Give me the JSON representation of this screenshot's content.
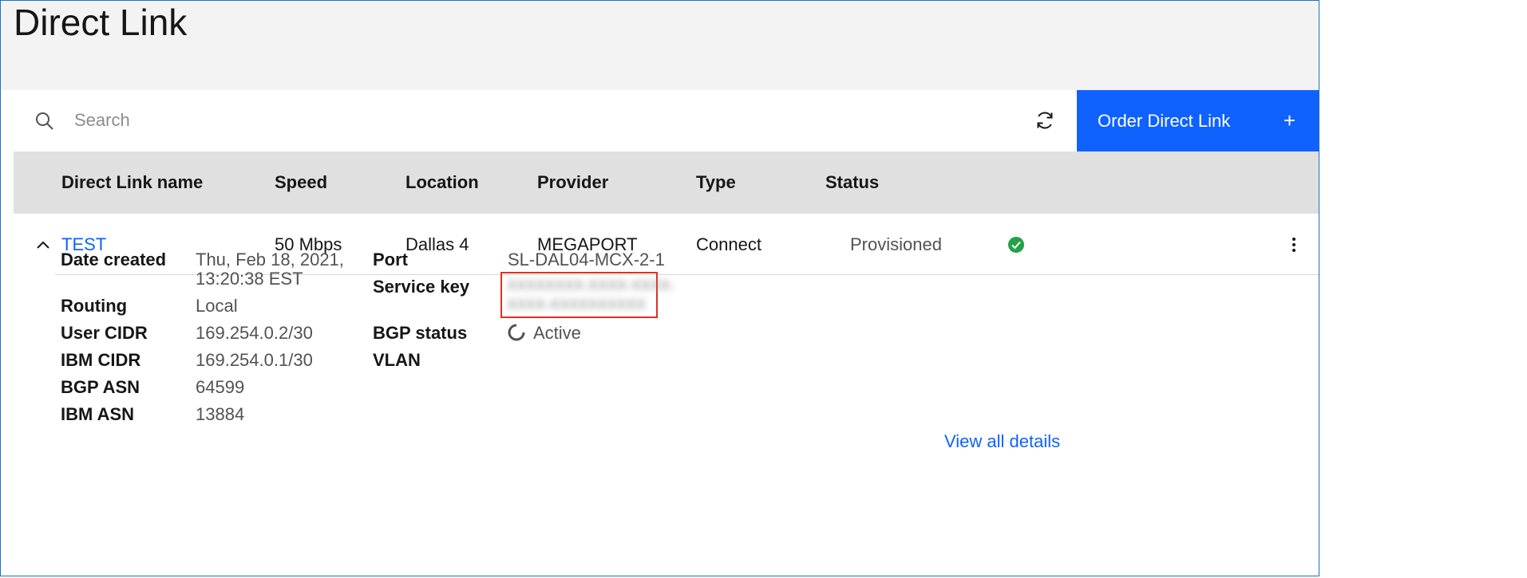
{
  "page": {
    "title": "Direct Link"
  },
  "toolbar": {
    "search_placeholder": "Search",
    "order_label": "Order Direct Link",
    "order_plus": "+"
  },
  "table": {
    "headers": [
      "Direct Link name",
      "Speed",
      "Location",
      "Provider",
      "Type",
      "Status"
    ],
    "rows": [
      {
        "name": "TEST",
        "speed": "50 Mbps",
        "location": "Dallas 4",
        "provider": "MEGAPORT",
        "type": "Connect",
        "status": "Provisioned"
      }
    ]
  },
  "details": {
    "date_created_label": "Date created",
    "date_created_line1": "Thu, Feb 18, 2021,",
    "date_created_line2": "13:20:38 EST",
    "routing_label": "Routing",
    "routing_value": "Local",
    "user_cidr_label": "User CIDR",
    "user_cidr_value": "169.254.0.2/30",
    "ibm_cidr_label": "IBM CIDR",
    "ibm_cidr_value": "169.254.0.1/30",
    "bgp_asn_label": "BGP ASN",
    "bgp_asn_value": "64599",
    "ibm_asn_label": "IBM ASN",
    "ibm_asn_value": "13884",
    "port_label": "Port",
    "port_value": "SL-DAL04-MCX-2-1",
    "service_key_label": "Service key",
    "bgp_status_label": "BGP status",
    "bgp_status_value": "Active",
    "vlan_label": "VLAN",
    "view_all_label": "View all details"
  },
  "colors": {
    "primary": "#0f62fe",
    "success": "#24a148",
    "highlight_border": "#e0301e",
    "header_bg": "#f3f3f3",
    "table_header_bg": "#e0e0e0"
  },
  "icons": {
    "search": "search-icon",
    "refresh": "refresh-icon",
    "add": "plus-icon",
    "expand": "chevron-up-icon",
    "status": "checkmark-filled-icon",
    "menu": "overflow-menu-icon",
    "bgp": "in-progress-icon"
  }
}
